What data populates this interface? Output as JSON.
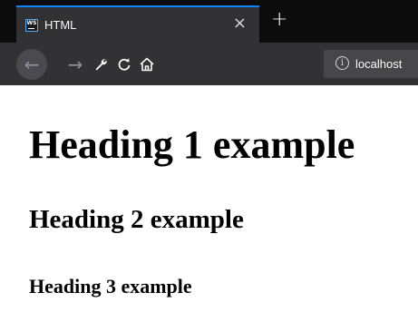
{
  "browser": {
    "tab": {
      "title": "HTML",
      "favicon": "webstorm-icon",
      "favicon_text": "WS",
      "close_icon": "close-icon",
      "close_glyph": "×"
    },
    "new_tab": {
      "icon": "plus-icon",
      "glyph": "+"
    },
    "toolbar": {
      "back": {
        "icon": "arrow-left-icon",
        "glyph": "←"
      },
      "forward": {
        "icon": "arrow-right-icon",
        "glyph": "→"
      },
      "tools": {
        "icon": "wrench-icon",
        "glyph": "🔧"
      },
      "reload": {
        "icon": "reload-icon",
        "glyph": "⟳"
      },
      "home": {
        "icon": "home-icon",
        "glyph": "⌂"
      }
    },
    "urlbar": {
      "info_icon": "info-icon",
      "info_glyph": "i",
      "url": "localhost"
    },
    "colors": {
      "tabstrip": "#0c0c0d",
      "active_tab": "#323234",
      "accent": "#0a84ff",
      "urlbar": "#474749"
    }
  },
  "page": {
    "h1": "Heading 1 example",
    "h2": "Heading 2 example",
    "h3": "Heading 3 example"
  }
}
